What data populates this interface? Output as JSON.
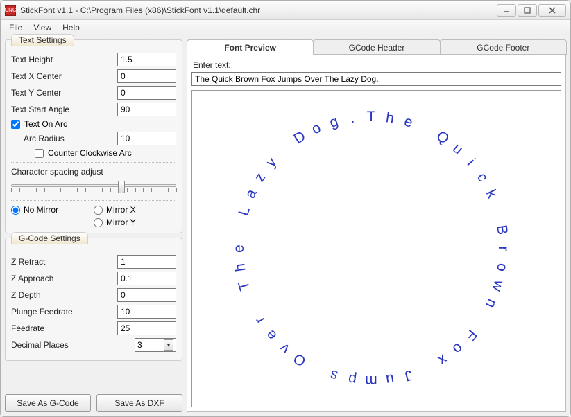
{
  "titlebar": {
    "title": "StickFont v1.1 - C:\\Program Files (x86)\\StickFont v1.1\\default.chr",
    "app_icon": "CNC"
  },
  "menu": {
    "file": "File",
    "view": "View",
    "help": "Help"
  },
  "text_settings": {
    "group_label": "Text Settings",
    "height_label": "Text Height",
    "height_value": "1.5",
    "xcenter_label": "Text X Center",
    "xcenter_value": "0",
    "ycenter_label": "Text Y Center",
    "ycenter_value": "0",
    "angle_label": "Text Start Angle",
    "angle_value": "90",
    "on_arc_label": "Text On Arc",
    "arc_radius_label": "Arc Radius",
    "arc_radius_value": "10",
    "ccw_label": "Counter Clockwise Arc",
    "char_spacing_label": "Character spacing adjust",
    "mirror_none": "No Mirror",
    "mirror_x": "Mirror X",
    "mirror_y": "Mirror Y"
  },
  "gcode_settings": {
    "group_label": "G-Code Settings",
    "z_retract_label": "Z Retract",
    "z_retract_value": "1",
    "z_approach_label": "Z Approach",
    "z_approach_value": "0.1",
    "z_depth_label": "Z Depth",
    "z_depth_value": "0",
    "plunge_label": "Plunge Feedrate",
    "plunge_value": "10",
    "feedrate_label": "Feedrate",
    "feedrate_value": "25",
    "decimal_label": "Decimal Places",
    "decimal_value": "3"
  },
  "buttons": {
    "save_gcode": "Save As G-Code",
    "save_dxf": "Save As DXF"
  },
  "tabs": {
    "preview": "Font Preview",
    "header": "GCode Header",
    "footer": "GCode Footer"
  },
  "preview_panel": {
    "enter_label": "Enter text:",
    "enter_value": "The Quick Brown Fox Jumps Over The Lazy Dog."
  }
}
